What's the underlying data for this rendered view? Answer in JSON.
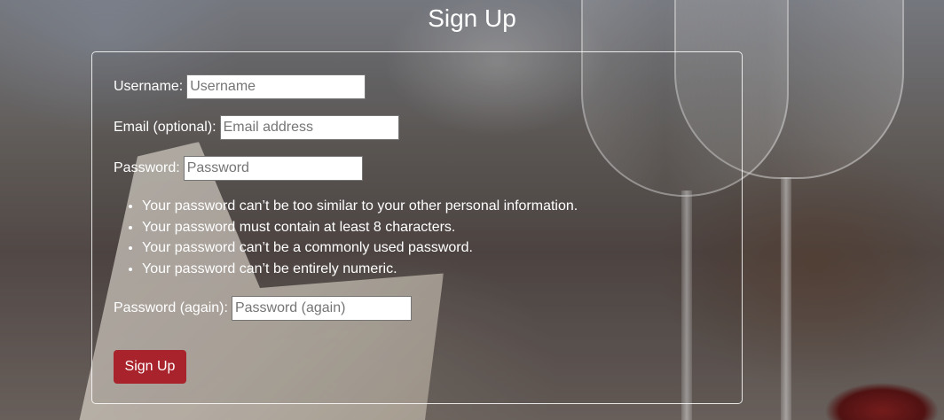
{
  "page": {
    "title": "Sign Up"
  },
  "form": {
    "username": {
      "label": "Username:",
      "placeholder": "Username",
      "value": ""
    },
    "email": {
      "label": "Email (optional):",
      "placeholder": "Email address",
      "value": ""
    },
    "password": {
      "label": "Password:",
      "placeholder": "Password",
      "value": ""
    },
    "password_rules": [
      "Your password can’t be too similar to your other personal information.",
      "Your password must contain at least 8 characters.",
      "Your password can’t be a commonly used password.",
      "Your password can’t be entirely numeric."
    ],
    "password_again": {
      "label": "Password (again):",
      "placeholder": "Password (again)",
      "value": ""
    },
    "submit_label": "Sign Up"
  },
  "colors": {
    "button": "#a8232b",
    "text": "#ffffff"
  }
}
